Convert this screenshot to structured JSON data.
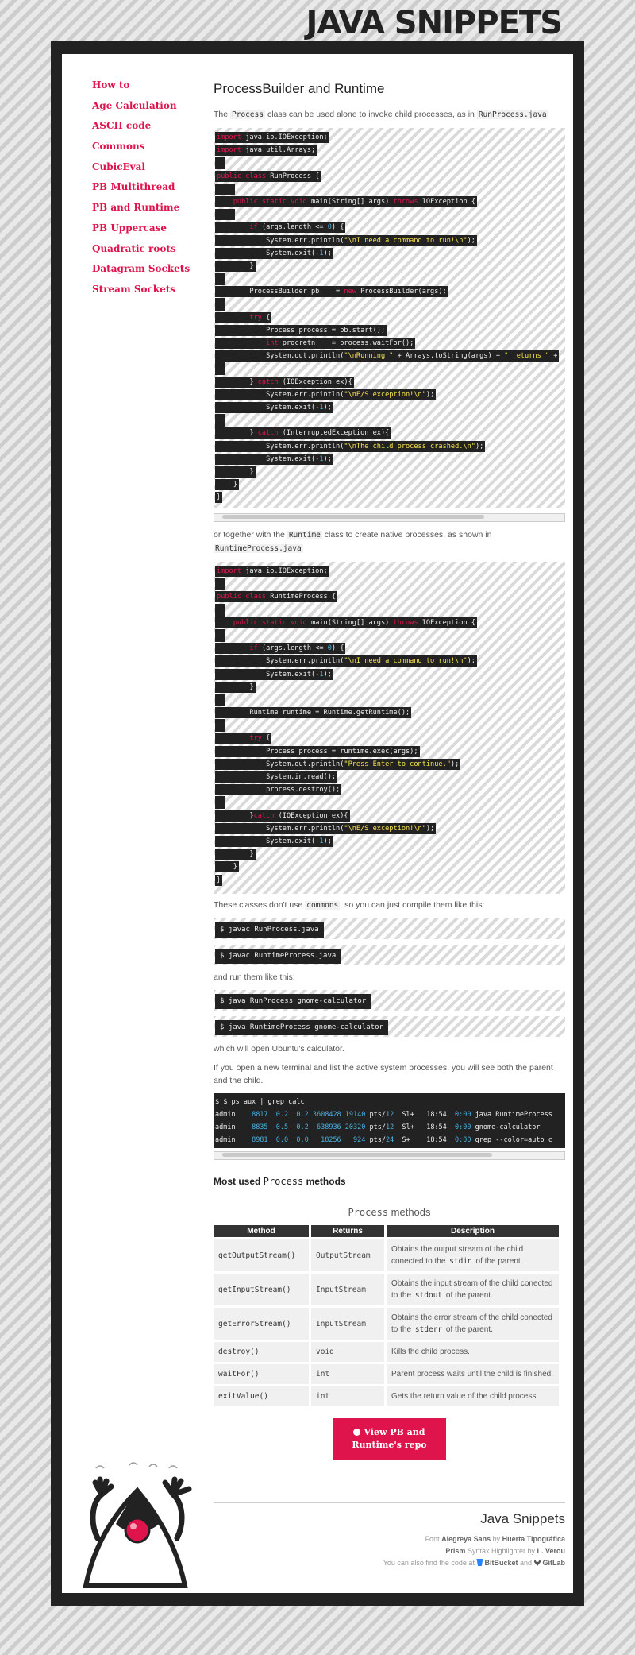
{
  "site_title": "JAVA SNIPPETS",
  "sidebar": {
    "items": [
      {
        "label": "How to"
      },
      {
        "label": "Age Calculation"
      },
      {
        "label": "ASCII code"
      },
      {
        "label": "Commons"
      },
      {
        "label": "CubicEval"
      },
      {
        "label": "PB Multithread"
      },
      {
        "label": "PB and Runtime"
      },
      {
        "label": "PB Uppercase"
      },
      {
        "label": "Quadratic roots"
      },
      {
        "label": "Datagram Sockets"
      },
      {
        "label": "Stream Sockets"
      }
    ]
  },
  "main": {
    "title": "ProcessBuilder and Runtime",
    "intro": {
      "pre": "The ",
      "code": "Process",
      "post": " class can be used alone to invoke child processes, as in ",
      "file": "RunProcess.java"
    },
    "code1": [
      [
        [
          "kw",
          "import"
        ],
        [
          "",
          "java.io.IOException;"
        ]
      ],
      [
        [
          "kw",
          "import"
        ],
        [
          "",
          "java.util.Arrays;"
        ]
      ],
      [],
      [
        [
          "kw",
          "public class"
        ],
        [
          "",
          "RunProcess {"
        ]
      ],
      [
        [
          "",
          "    "
        ]
      ],
      [
        [
          "",
          "    "
        ],
        [
          "kw",
          "public static void"
        ],
        [
          "",
          "main(String[] args) "
        ],
        [
          "kw",
          "throws"
        ],
        [
          "",
          "IOException {"
        ]
      ],
      [
        [
          "",
          "    "
        ]
      ],
      [
        [
          "",
          "        "
        ],
        [
          "kw",
          "if"
        ],
        [
          "",
          "(args.length <= "
        ],
        [
          "num",
          "0"
        ],
        [
          "",
          ") {"
        ]
      ],
      [
        [
          "",
          "            System.err.println("
        ],
        [
          "str",
          "\"\\nI need a command to run!\\n\""
        ],
        [
          "",
          ");"
        ]
      ],
      [
        [
          "",
          "            System.exit("
        ],
        [
          "num",
          "-1"
        ],
        [
          "",
          ");"
        ]
      ],
      [
        [
          "",
          "        }"
        ]
      ],
      [],
      [
        [
          "",
          "        ProcessBuilder pb    = "
        ],
        [
          "kw",
          "new"
        ],
        [
          "",
          "ProcessBuilder(args);"
        ]
      ],
      [],
      [
        [
          "",
          "        "
        ],
        [
          "kw",
          "try"
        ],
        [
          "",
          "{"
        ]
      ],
      [
        [
          "",
          "            Process process = pb.start();"
        ]
      ],
      [
        [
          "",
          "            "
        ],
        [
          "kw",
          "int"
        ],
        [
          "",
          "procretn    = process.waitFor();"
        ]
      ],
      [
        [
          "",
          "            System.out.println("
        ],
        [
          "str",
          "\"\\nRunning \""
        ],
        [
          "",
          " + Arrays.toString(args) + "
        ],
        [
          "str",
          "\" returns \""
        ],
        [
          "",
          " +"
        ]
      ],
      [],
      [
        [
          "",
          "        } "
        ],
        [
          "kw",
          "catch"
        ],
        [
          "",
          "(IOException ex){"
        ]
      ],
      [
        [
          "",
          "            System.err.println("
        ],
        [
          "str",
          "\"\\nE/S exception!\\n\""
        ],
        [
          "",
          ");"
        ]
      ],
      [
        [
          "",
          "            System.exit("
        ],
        [
          "num",
          "-1"
        ],
        [
          "",
          ");"
        ]
      ],
      [],
      [
        [
          "",
          "        } "
        ],
        [
          "kw",
          "catch"
        ],
        [
          "",
          "(InterruptedException ex){"
        ]
      ],
      [
        [
          "",
          "            System.err.println("
        ],
        [
          "str",
          "\"\\nThe child process crashed.\\n\""
        ],
        [
          "",
          ");"
        ]
      ],
      [
        [
          "",
          "            System.exit("
        ],
        [
          "num",
          "-1"
        ],
        [
          "",
          ");"
        ]
      ],
      [
        [
          "",
          "        }"
        ]
      ],
      [
        [
          "",
          "    }"
        ]
      ],
      [
        [
          "",
          "}"
        ]
      ]
    ],
    "between": {
      "pre": "or together with the ",
      "code": "Runtime",
      "post": " class to create native processes, as shown in ",
      "file": "RuntimeProcess.java"
    },
    "code2": [
      [
        [
          "kw",
          "import"
        ],
        [
          "",
          "java.io.IOException;"
        ]
      ],
      [],
      [
        [
          "kw",
          "public class"
        ],
        [
          "",
          "RuntimeProcess {"
        ]
      ],
      [],
      [
        [
          "",
          "    "
        ],
        [
          "kw",
          "public static void"
        ],
        [
          "",
          "main(String[] args) "
        ],
        [
          "kw",
          "throws"
        ],
        [
          "",
          "IOException {"
        ]
      ],
      [],
      [
        [
          "",
          "        "
        ],
        [
          "kw",
          "if"
        ],
        [
          "",
          "(args.length <= "
        ],
        [
          "num",
          "0"
        ],
        [
          "",
          ") {"
        ]
      ],
      [
        [
          "",
          "            System.err.println("
        ],
        [
          "str",
          "\"\\nI need a command to run!\\n\""
        ],
        [
          "",
          ");"
        ]
      ],
      [
        [
          "",
          "            System.exit("
        ],
        [
          "num",
          "-1"
        ],
        [
          "",
          ");"
        ]
      ],
      [
        [
          "",
          "        }"
        ]
      ],
      [],
      [
        [
          "",
          "        Runtime runtime = Runtime.getRuntime();"
        ]
      ],
      [],
      [
        [
          "",
          "        "
        ],
        [
          "kw",
          "try"
        ],
        [
          "",
          "{"
        ]
      ],
      [
        [
          "",
          "            Process process = runtime.exec(args);"
        ]
      ],
      [
        [
          "",
          "            System.out.println("
        ],
        [
          "str",
          "\"Press Enter to continue.\""
        ],
        [
          "",
          ");"
        ]
      ],
      [
        [
          "",
          "            System.in.read();"
        ]
      ],
      [
        [
          "",
          "            process.destroy();"
        ]
      ],
      [],
      [
        [
          "",
          "        }"
        ],
        [
          "kw",
          "catch"
        ],
        [
          "",
          "(IOException ex){"
        ]
      ],
      [
        [
          "",
          "            System.err.println("
        ],
        [
          "str",
          "\"\\nE/S exception!\\n\""
        ],
        [
          "",
          ");"
        ]
      ],
      [
        [
          "",
          "            System.exit("
        ],
        [
          "num",
          "-1"
        ],
        [
          "",
          ");"
        ]
      ],
      [
        [
          "",
          "        }"
        ]
      ],
      [
        [
          "",
          "    }"
        ]
      ],
      [
        [
          "",
          "}"
        ]
      ]
    ],
    "compile_note": {
      "pre": "These classes don't use ",
      "code": "commons",
      "post": ", so you can just compile them like this:"
    },
    "compile_cmds": [
      "$ javac RunProcess.java",
      "$ javac RuntimeProcess.java"
    ],
    "run_note": "and run them like this:",
    "run_cmds": [
      "$ java RunProcess gnome-calculator",
      "$ java RuntimeProcess gnome-calculator"
    ],
    "calc_note": "which will open Ubuntu's calculator.",
    "ps_note": "If you open a new terminal and list the active system processes, you will see both the parent and the child.",
    "ps_cmd": "$ $ ps aux | grep calc",
    "ps_rows": [
      {
        "user": "admin",
        "pid": "8817",
        "cpu": "0.2",
        "mem": "0.2",
        "vsz": "3608428",
        "rss": "19140",
        "tty": "pts/12",
        "stat": "Sl+",
        "start": "18:54",
        "time": "0:00",
        "cmd": "java RuntimeProcess"
      },
      {
        "user": "admin",
        "pid": "8835",
        "cpu": "0.5",
        "mem": "0.2",
        "vsz": "638936",
        "rss": "20320",
        "tty": "pts/12",
        "stat": "Sl+",
        "start": "18:54",
        "time": "0:00",
        "cmd": "gnome-calculator"
      },
      {
        "user": "admin",
        "pid": "8981",
        "cpu": "0.0",
        "mem": "0.0",
        "vsz": "18256",
        "rss": "924",
        "tty": "pts/24",
        "stat": "S+",
        "start": "18:54",
        "time": "0:00",
        "cmd": "grep --color=auto c"
      }
    ],
    "methods_heading": {
      "pre": "Most used ",
      "code": "Process",
      "post": " methods"
    },
    "table": {
      "caption_code": "Process",
      "caption_text": " methods",
      "headers": [
        "Method",
        "Returns",
        "Description"
      ],
      "rows": [
        {
          "method": "getOutputStream()",
          "returns": "OutputStream",
          "desc_pre": "Obtains the output stream of the child conected to the ",
          "desc_code": "stdin",
          "desc_post": " of the parent."
        },
        {
          "method": "getInputStream()",
          "returns": "InputStream",
          "desc_pre": "Obtains the input stream of the child conected to the ",
          "desc_code": "stdout",
          "desc_post": " of the parent."
        },
        {
          "method": "getErrorStream()",
          "returns": "InputStream",
          "desc_pre": "Obtains the error stream of the child conected to the ",
          "desc_code": "stderr",
          "desc_post": " of the parent."
        },
        {
          "method": "destroy()",
          "returns": "void",
          "desc_pre": "Kills the child process.",
          "desc_code": "",
          "desc_post": ""
        },
        {
          "method": "waitFor()",
          "returns": "int",
          "desc_pre": "Parent process waits until the child is finished.",
          "desc_code": "",
          "desc_post": ""
        },
        {
          "method": "exitValue()",
          "returns": "int",
          "desc_pre": "Gets the return value of the child process.",
          "desc_code": "",
          "desc_post": ""
        }
      ]
    },
    "repo_button": {
      "line1": "View PB and",
      "line2": "Runtime's repo"
    }
  },
  "footer": {
    "name": "Java Snippets",
    "font_pre": "Font ",
    "font_name": "Alegreya Sans",
    "font_by": " by ",
    "font_author": "Huerta Tipográfica",
    "prism": "Prism",
    "prism_mid": " Syntax Highlighter by ",
    "prism_author": "L. Verou",
    "code_pre": "You can also find the code at ",
    "bitbucket": "BitBucket",
    "and": " and ",
    "gitlab": "GitLab"
  },
  "colors": {
    "accent": "#e0144c",
    "dark": "#222222",
    "string": "#f7e34a",
    "number": "#4ab0e0"
  }
}
